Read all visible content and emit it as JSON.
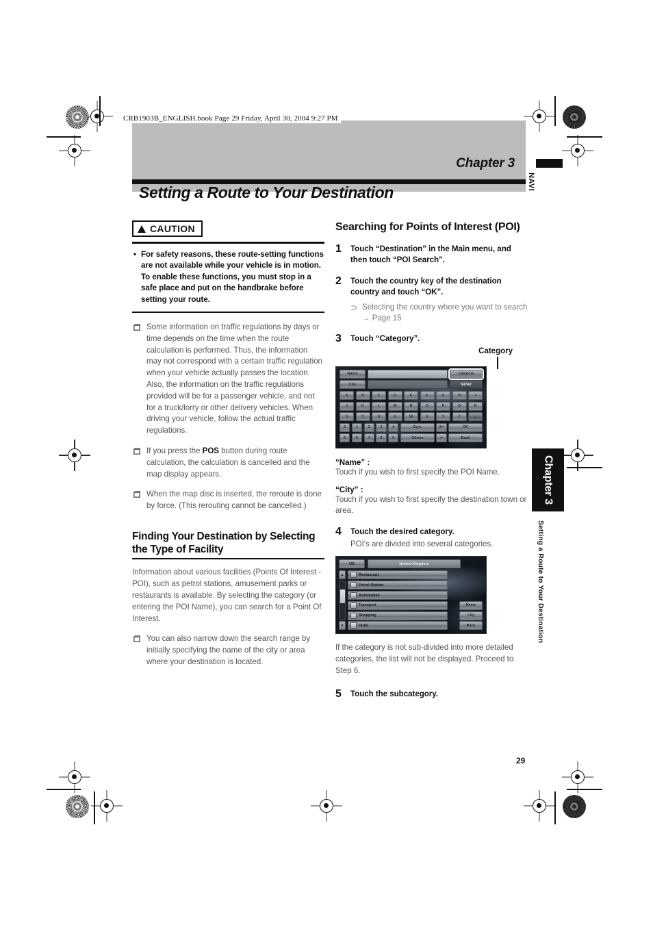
{
  "print": {
    "file_path": "CRB1903B_ENGLISH.book  Page 29  Friday, April 30, 2004  9:27 PM"
  },
  "header": {
    "chapter_label": "Chapter 3",
    "chapter_title": "Setting a Route to Your Destination"
  },
  "side": {
    "navi_tab": "NAVI",
    "chapter_tab": "Chapter 3",
    "running_head": "Setting a Route to Your Destination",
    "page_number": "29"
  },
  "left_column": {
    "caution": {
      "badge_label": "CAUTION",
      "bullet": "•",
      "text": "For safety reasons, these route-setting functions are not available while your vehicle is in motion. To enable these functions, you must stop in a safe place and put on the handbrake before setting your route."
    },
    "notes": [
      {
        "text_pre": "Some information on traffic regulations by days or time depends on the time when the route calculation is performed. Thus, the information may not correspond with a certain traffic regulation when your vehicle actually passes the location. Also, the information on the traffic regulations provided will be for a passenger vehicle, and not for a truck/lorry or other delivery vehicles. When driving your vehicle, follow the actual traffic regulations.",
        "bold": "",
        "text_post": ""
      },
      {
        "text_pre": "If you press the ",
        "bold": "POS",
        "text_post": " button during route calculation, the calculation is cancelled and the map display appears."
      },
      {
        "text_pre": "When the map disc is inserted, the reroute is done by force. (This rerouting cannot be cancelled.)",
        "bold": "",
        "text_post": ""
      }
    ],
    "section": {
      "heading": "Finding Your Destination by Selecting the Type of Facility",
      "paragraph": "Information about various facilities (Points Of Interest - POI), such as petrol stations, amusement parks or restaurants is available. By selecting the category (or entering the POI Name), you can search for a Point Of Interest.",
      "note": "You can also narrow down the search range by initially specifying the name of the city or area where your destination is located."
    }
  },
  "right_column": {
    "heading": "Searching for Points of Interest (POI)",
    "steps": [
      {
        "num": "1",
        "text": "Touch “Destination” in the Main menu, and then touch “POI Search”."
      },
      {
        "num": "2",
        "text": "Touch the country key of the destination country and touch “OK”.",
        "sub_arrow": "⊃",
        "sub_text": "Selecting the country where you want to search → Page 15"
      },
      {
        "num": "3",
        "text": "Touch “Category”."
      },
      {
        "num": "4",
        "text": "Touch the desired category.",
        "sub_para": "POI's are divided into several categories.",
        "after_para": "If the category is not sub-divided into more detailed categories, the list will not be displayed. Proceed to Step 6."
      },
      {
        "num": "5",
        "text": "Touch the subcategory."
      }
    ],
    "callout": {
      "label": "Category"
    },
    "terms": [
      {
        "label": "“Name” :",
        "desc": "Touch if you wish to first specify the POI Name."
      },
      {
        "label": "“City” :",
        "desc": "Touch if you wish to first specify the destination town or area."
      }
    ]
  },
  "screenshot_keyboard": {
    "name_key": "Name",
    "city_key": "City",
    "name_entry_value": "...",
    "city_entry_value": "",
    "category_key": "Category",
    "result_count": "54742",
    "rows": [
      [
        "A",
        "B",
        "C",
        "D",
        "E",
        "F",
        "G",
        "H",
        "I"
      ],
      [
        "J",
        "K",
        "L",
        "M",
        "N",
        "O",
        "P",
        "Q",
        "R"
      ],
      [
        "S",
        "T",
        "U",
        "V",
        "W",
        "X",
        "Y",
        "Z",
        "␣"
      ],
      [
        "0",
        "1",
        "2",
        "3",
        "4"
      ],
      [
        "5",
        "6",
        "7",
        "8",
        "9"
      ]
    ],
    "func_keys_row4": [
      "Sym.",
      "U↵",
      "OK"
    ],
    "func_keys_row5": [
      "Others",
      "⇦",
      "Back"
    ]
  },
  "screenshot_list": {
    "country_key": "UK",
    "country_title": "United Kingdom",
    "items": [
      "Restaurant",
      "Petrol Station",
      "Automobile",
      "Transport",
      "Shopping",
      "Hotel"
    ],
    "side_keys": [
      "Name",
      "City",
      "Back"
    ],
    "scroll_up": "▲",
    "scroll_down": "▼"
  }
}
